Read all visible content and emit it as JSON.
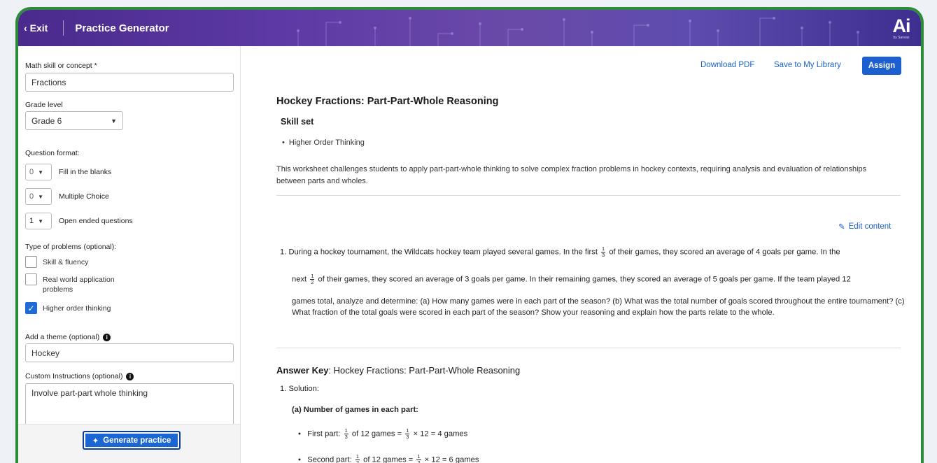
{
  "header": {
    "exit_label": "Exit",
    "title": "Practice Generator",
    "logo_text": "Ai",
    "logo_sub": "by Savvas"
  },
  "sidebar": {
    "skill_label": "Math skill or concept *",
    "skill_value": "Fractions",
    "grade_label": "Grade level",
    "grade_value": "Grade 6",
    "format_label": "Question format:",
    "formats": [
      {
        "count": "0",
        "label": "Fill in the blanks"
      },
      {
        "count": "0",
        "label": "Multiple Choice"
      },
      {
        "count": "1",
        "label": "Open ended questions"
      }
    ],
    "types_label": "Type of problems (optional):",
    "types": [
      {
        "label": "Skill & fluency",
        "checked": false
      },
      {
        "label": "Real world application problems",
        "checked": false
      },
      {
        "label": "Higher order thinking",
        "checked": true
      }
    ],
    "theme_label": "Add a theme (optional)",
    "theme_value": "Hockey",
    "custom_label": "Custom Instructions (optional)",
    "custom_value": "Involve part-part whole thinking",
    "generate_label": "Generate practice"
  },
  "toolbar": {
    "download_label": "Download PDF",
    "save_label": "Save to My Library",
    "assign_label": "Assign"
  },
  "worksheet": {
    "title": "Hockey Fractions: Part-Part-Whole Reasoning",
    "skill_heading": "Skill set",
    "skills": [
      "Higher Order Thinking"
    ],
    "description": "This worksheet challenges students to apply part-part-whole thinking to solve complex fraction problems in hockey contexts, requiring analysis and evaluation of relationships between parts and wholes.",
    "edit_label": "Edit content",
    "q1_part1": "1. During a hockey tournament, the Wildcats hockey team played several games. In the first",
    "q1_frac1_num": "1",
    "q1_frac1_den": "3",
    "q1_part2": "of their games, they scored an average of 4 goals per game. In the",
    "q1_part3": "next",
    "q1_frac2_num": "1",
    "q1_frac2_den": "2",
    "q1_part4": "of their games, they scored an average of 3 goals per game. In their remaining games, they scored an average of 5 goals per game. If the team played 12",
    "q1_part5": "games total, analyze and determine: (a) How many games were in each part of the season? (b) What was the total number of goals scored throughout the entire tournament? (c) What fraction of the total goals were scored in each part of the season? Show your reasoning and explain how the parts relate to the whole."
  },
  "answer_key": {
    "label": "Answer Key",
    "title": ": Hockey Fractions: Part-Part-Whole Reasoning",
    "solution_label": "1. Solution:",
    "part_a_label": "(a) Number of games in each part:",
    "line1_prefix": "First part:",
    "line1_text": "of 12 games =",
    "line1_result": "× 12 = 4 games",
    "line1_num": "1",
    "line1_den": "3",
    "line2_prefix": "Second part:",
    "line2_text": "of 12 games =",
    "line2_result": "× 12 = 6 games",
    "line2_num": "1",
    "line2_den": "2"
  },
  "colors": {
    "frame_green": "#2e8b3a",
    "header_purple": "#5d3aa6",
    "link_blue": "#1a5fc8",
    "primary_blue": "#1b5fd0"
  }
}
